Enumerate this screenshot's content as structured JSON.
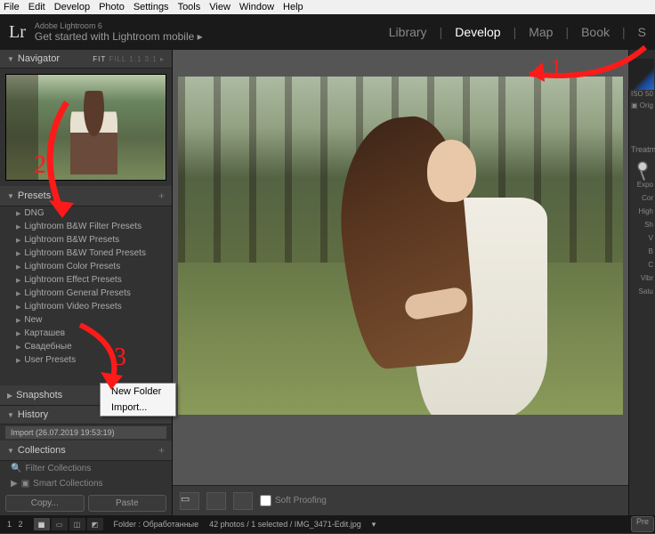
{
  "menubar": [
    "File",
    "Edit",
    "Develop",
    "Photo",
    "Settings",
    "Tools",
    "View",
    "Window",
    "Help"
  ],
  "header": {
    "app_title": "Adobe Lightroom 6",
    "subtitle": "Get started with Lightroom mobile",
    "logo": "Lr"
  },
  "modules": {
    "items": [
      "Library",
      "Develop",
      "Map",
      "Book",
      "S"
    ],
    "active": "Develop"
  },
  "navigator": {
    "title": "Navigator",
    "tabs": [
      "FIT",
      "FILL",
      "1:1",
      "3:1"
    ],
    "active_tab": "FIT"
  },
  "presets": {
    "title": "Presets",
    "items": [
      "DNG",
      "Lightroom B&W Filter Presets",
      "Lightroom B&W Presets",
      "Lightroom B&W Toned Presets",
      "Lightroom Color Presets",
      "Lightroom Effect Presets",
      "Lightroom General Presets",
      "Lightroom Video Presets",
      "New",
      "Карташев",
      "Свадебные",
      "User Presets"
    ]
  },
  "snapshots": {
    "title": "Snapshots"
  },
  "history": {
    "title": "History",
    "entry": "Import (26.07.2019 19:53:19)"
  },
  "collections": {
    "title": "Collections",
    "filter": "Filter Collections",
    "smart": "Smart Collections"
  },
  "buttons": {
    "copy": "Copy...",
    "paste": "Paste"
  },
  "context_menu": {
    "new_folder": "New Folder",
    "import": "Import..."
  },
  "center": {
    "soft_proofing": "Soft Proofing",
    "pre": "Pre"
  },
  "right": {
    "iso": "ISO 50",
    "orig": "Orig",
    "treatment": "Treatme",
    "labels": [
      "Expo",
      "Cor",
      "High",
      "Sh",
      "V",
      "B",
      "C",
      "Vibr",
      "Satu"
    ]
  },
  "status": {
    "page": "1",
    "total": "2",
    "folder_label": "Folder :",
    "folder_name": "Обработанные",
    "summary": "42 photos / 1 selected / IMG_3471-Edit.jpg"
  },
  "annotations": {
    "n1": "1",
    "n2": "2",
    "n3": "3"
  }
}
